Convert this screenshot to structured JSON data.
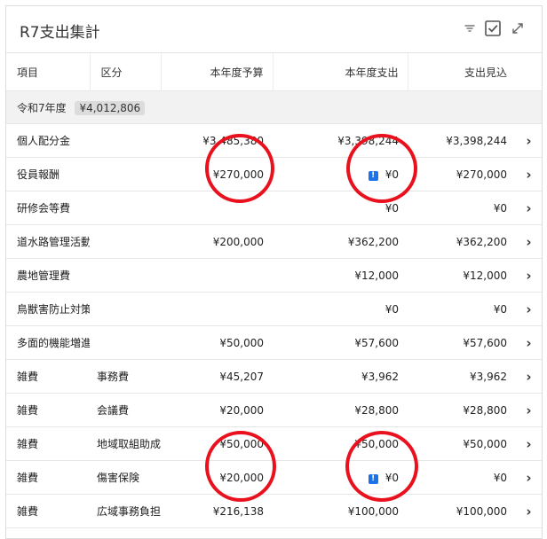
{
  "widget": {
    "title": "R7支出集計"
  },
  "icons": {
    "filter": "filter-icon",
    "check": "checkbox-checked-icon",
    "expand": "expand-icon",
    "chevron": "chevron-right-icon",
    "warning": "warning-icon"
  },
  "columns": {
    "item": "項目",
    "category": "区分",
    "budget": "本年度予算",
    "spent": "本年度支出",
    "forecast": "支出見込"
  },
  "group": {
    "label": "令和7年度",
    "total": "¥4,012,806"
  },
  "rows": [
    {
      "item": "個人配分金",
      "category": "",
      "budget": "¥3,485,380",
      "spent": "¥3,398,244",
      "forecast": "¥3,398,244",
      "warning": false
    },
    {
      "item": "役員報酬",
      "category": "",
      "budget": "¥270,000",
      "spent": "¥0",
      "forecast": "¥270,000",
      "warning": true
    },
    {
      "item": "研修会等費",
      "category": "",
      "budget": "",
      "spent": "¥0",
      "forecast": "¥0",
      "warning": false
    },
    {
      "item": "道水路管理活動",
      "category": "",
      "budget": "¥200,000",
      "spent": "¥362,200",
      "forecast": "¥362,200",
      "warning": false
    },
    {
      "item": "農地管理費",
      "category": "",
      "budget": "",
      "spent": "¥12,000",
      "forecast": "¥12,000",
      "warning": false
    },
    {
      "item": "鳥獣害防止対策",
      "category": "",
      "budget": "",
      "spent": "¥0",
      "forecast": "¥0",
      "warning": false
    },
    {
      "item": "多面的機能増進",
      "category": "",
      "budget": "¥50,000",
      "spent": "¥57,600",
      "forecast": "¥57,600",
      "warning": false
    },
    {
      "item": "雑費",
      "category": "事務費",
      "budget": "¥45,207",
      "spent": "¥3,962",
      "forecast": "¥3,962",
      "warning": false
    },
    {
      "item": "雑費",
      "category": "会議費",
      "budget": "¥20,000",
      "spent": "¥28,800",
      "forecast": "¥28,800",
      "warning": false
    },
    {
      "item": "雑費",
      "category": "地域取組助成",
      "budget": "¥50,000",
      "spent": "¥50,000",
      "forecast": "¥50,000",
      "warning": false
    },
    {
      "item": "雑費",
      "category": "傷害保険",
      "budget": "¥20,000",
      "spent": "¥0",
      "forecast": "¥0",
      "warning": true
    },
    {
      "item": "雑費",
      "category": "広域事務負担",
      "budget": "¥216,138",
      "spent": "¥100,000",
      "forecast": "¥100,000",
      "warning": false
    }
  ]
}
